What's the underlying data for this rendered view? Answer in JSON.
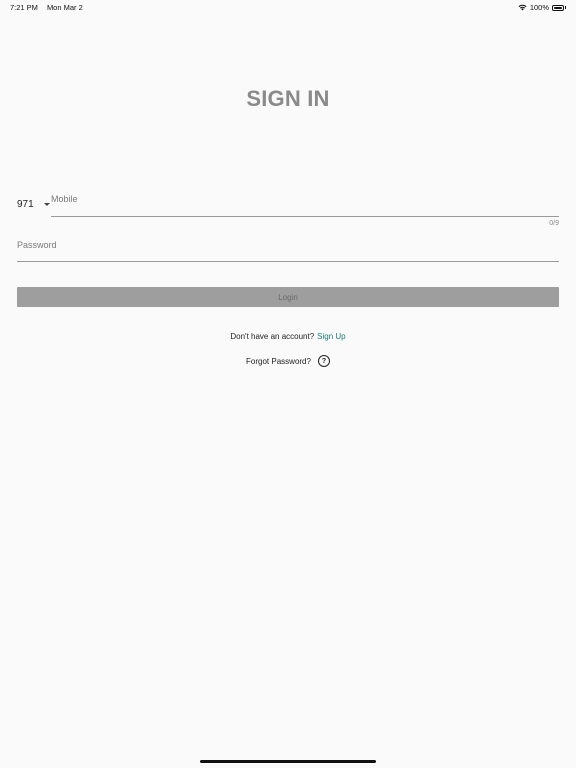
{
  "status_bar": {
    "time": "7:21 PM",
    "date": "Mon Mar 2",
    "battery": "100%"
  },
  "title": "SIGN IN",
  "form": {
    "country_code": "971",
    "mobile_label": "Mobile",
    "mobile_counter": "0/9",
    "password_label": "Password",
    "login_label": "Login"
  },
  "links": {
    "signup_prompt": "Don't have an account?",
    "signup_label": "Sign Up",
    "forgot_label": "Forgot Password?",
    "help_symbol": "?"
  },
  "colors": {
    "background": "#fafafa",
    "title": "#8a8a8a",
    "button": "#9e9e9e",
    "link": "#1e7a78"
  },
  "icons": [
    "wifi-icon",
    "battery-icon",
    "dropdown-caret-icon",
    "help-icon"
  ]
}
